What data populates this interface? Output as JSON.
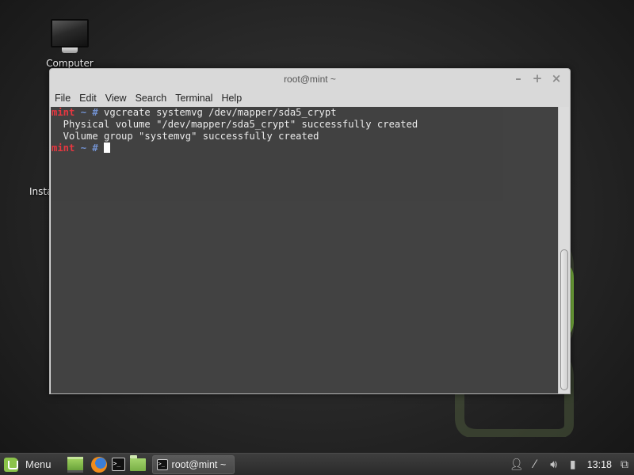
{
  "desktop": {
    "icons": [
      {
        "label": "Computer",
        "icon": "computer-icon"
      },
      {
        "label": "Install Linux Mint",
        "icon": "disc-icon"
      }
    ]
  },
  "window": {
    "title": "root@mint ~",
    "controls": {
      "minimize": "–",
      "maximize": "+",
      "close": "×"
    },
    "menu": [
      "File",
      "Edit",
      "View",
      "Search",
      "Terminal",
      "Help"
    ]
  },
  "terminal": {
    "lines": [
      {
        "host": "mint",
        "path": " ~ # ",
        "command": "vgcreate systemvg /dev/mapper/sda5_crypt"
      },
      {
        "output": "  Physical volume \"/dev/mapper/sda5_crypt\" successfully created"
      },
      {
        "output": "  Volume group \"systemvg\" successfully created"
      },
      {
        "host": "mint",
        "path": " ~ # ",
        "command": ""
      }
    ],
    "colors": {
      "host": "#e8323c",
      "prompt": "#6f8fcf",
      "background": "#3d3d3d"
    }
  },
  "panel": {
    "menu_label": "Menu",
    "launchers": [
      "show-desktop",
      "firefox",
      "terminal",
      "files"
    ],
    "task": {
      "label": "root@mint ~",
      "icon": "terminal-icon"
    },
    "tray": [
      "user-icon",
      "network-icon",
      "volume-icon",
      "battery-icon"
    ],
    "clock": "13:18"
  }
}
